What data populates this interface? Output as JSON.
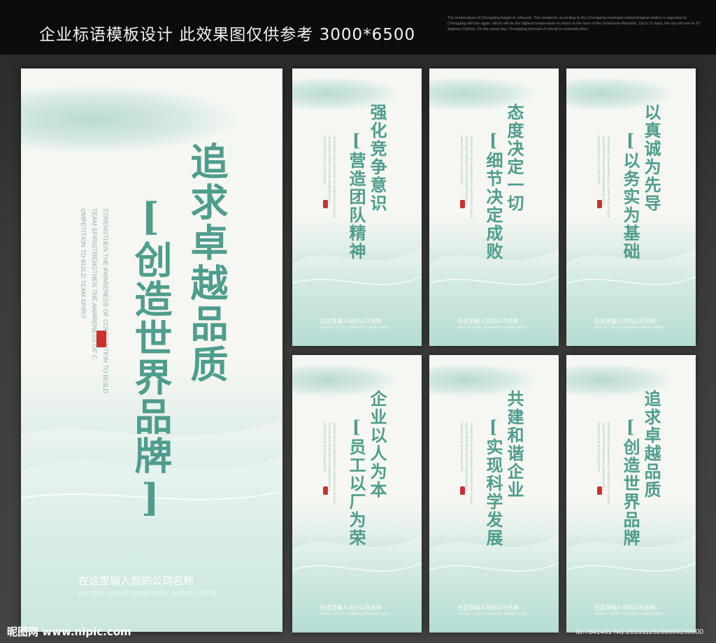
{
  "header": {
    "title": "企业标语模板设计 此效果图仅供参考 3000*6500",
    "note": "The temperature of Chongqing began to rebound. This weekend, according to the Chongqing municipal meteorological station is expected to Chongqing will rise again, which will be the highest temperature to return to the level of the Dominican Republic. Up to 11 days, the city will rise to 37 degrees Celsius. On the same day, Chongqing forecast of cloudy to overcast skies."
  },
  "big_panel": {
    "line1": "追求卓越品质",
    "line2": "[创造世界品牌]",
    "eng1": "STRENGTHEN THE AWARENESS OF COMPETITION TO BUILD",
    "eng2": "TEAM SPIRISTRENGTHEN THE AWARENESS OF C",
    "eng3": "OMPETITION TO BUILD TEAM SPIRIT",
    "company": "在这里输入您的公司名称",
    "company_en": "ENTER YOUR COMPANY NAME HERE"
  },
  "small_panels": [
    {
      "line1": "强化竞争意识",
      "line2": "[营造团队精神",
      "eng1": "STRENGTHEN THE AWARENESS OF COMPETITION TO BUILD",
      "eng2": "TEAM SPIRITSTRENGTHEN THE AWARENESS OF C",
      "eng3": "OMPETITION TO BUILD TEAM SPIRIT",
      "company": "在这里输入您的公司名称",
      "company_en": "ENTER YOUR COMPANY NAME HERE"
    },
    {
      "line1": "态度决定一切",
      "line2": "[细节决定成败",
      "eng1": "STRENGTHEN THE AWARENESS OF COMPETITION TO BUILD",
      "eng2": "TEAM SPIRITSTRENGTHEN THE AWARENESS OF C",
      "eng3": "OMPETITION TO BUILD TEAM SPIRIT",
      "company": "在这里输入您的公司名称",
      "company_en": "ENTER YOUR COMPANY NAME HERE"
    },
    {
      "line1": "以真诚为先导",
      "line2": "[以务实为基础",
      "eng1": "STRENGTHEN THE AWARENESS OF COMPETITION TO BUILD",
      "eng2": "TEAM SPIRITSTRENGTHEN THE AWARENESS OF C",
      "eng3": "OMPETITION TO BUILD TEAM SPIRIT",
      "company": "在这里输入您的公司名称",
      "company_en": "ENTER YOUR COMPANY NAME HERE"
    },
    {
      "line1": "企业以人为本",
      "line2": "[员工以厂为荣",
      "eng1": "STRENGTHEN THE AWARENESS OF COMPETITION TO BUILD",
      "eng2": "TEAM SPIRITSTRENGTHEN THE AWARENESS OF C",
      "eng3": "OMPETITION TO BUILD TEAM SPIRIT",
      "company": "在这里输入您的公司名称",
      "company_en": "ENTER YOUR COMPANY NAME HERE"
    },
    {
      "line1": "共建和谐企业",
      "line2": "[实现科学发展",
      "eng1": "STRENGTHEN THE AWARENESS OF COMPETITION TO BUILD",
      "eng2": "TEAM SPIRITSTRENGTHEN THE AWARENESS OF C",
      "eng3": "OMPETITION TO BUILD TEAM SPIRIT",
      "company": "在这里输入您的公司名称",
      "company_en": "ENTER YOUR COMPANY NAME HERE"
    },
    {
      "line1": "追求卓越品质",
      "line2": "[创造世界品牌",
      "eng1": "STRENGTHEN THE AWARENESS OF COMPETITION TO BUILD",
      "eng2": "TEAM SPIRITSTRENGTHEN THE AWARENESS OF C",
      "eng3": "OMPETITION TO BUILD TEAM SPIRIT",
      "company": "在这里输入您的公司名称",
      "company_en": "ENTER YOUR COMPANY NAME HERE"
    }
  ],
  "footer": {
    "watermark": "昵图网 www.nipic.com",
    "id_line": "ID:7841461 NO:20181126203900298000"
  },
  "colors": {
    "accent": "#4f9d8d",
    "seal": "#c8322f",
    "background": "#3a3a3a"
  }
}
